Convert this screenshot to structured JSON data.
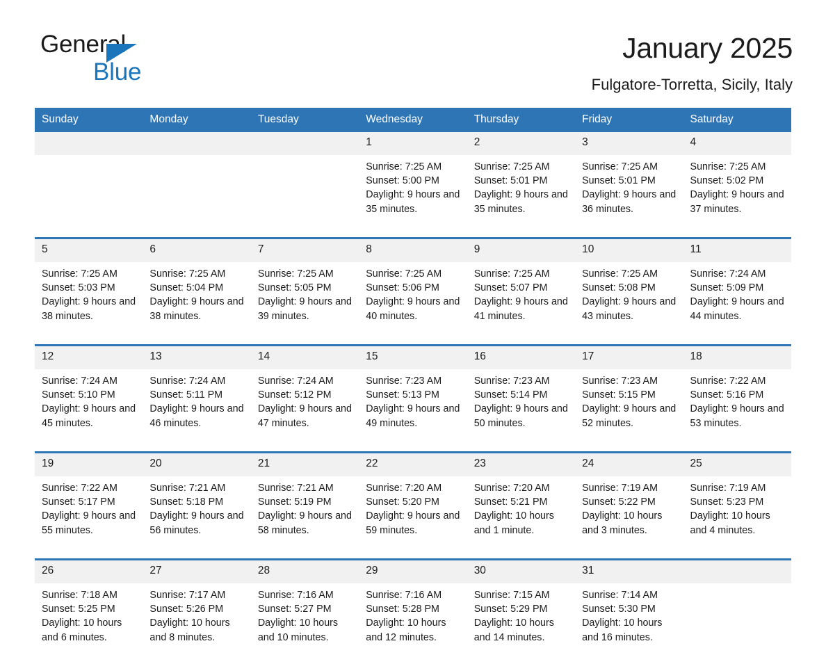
{
  "logo": {
    "word1": "General",
    "word2": "Blue",
    "accent_color": "#1b75bb",
    "triangle_icon": "triangle-icon"
  },
  "header": {
    "title": "January 2025",
    "subtitle": "Fulgatore-Torretta, Sicily, Italy"
  },
  "calendar": {
    "header_bg": "#2e75b6",
    "daynum_bg": "#f1f1f1",
    "weekdays": [
      "Sunday",
      "Monday",
      "Tuesday",
      "Wednesday",
      "Thursday",
      "Friday",
      "Saturday"
    ],
    "labels": {
      "sunrise": "Sunrise:",
      "sunset": "Sunset:",
      "daylight": "Daylight:"
    },
    "weeks": [
      [
        {
          "day": "",
          "sunrise": "",
          "sunset": "",
          "daylight": ""
        },
        {
          "day": "",
          "sunrise": "",
          "sunset": "",
          "daylight": ""
        },
        {
          "day": "",
          "sunrise": "",
          "sunset": "",
          "daylight": ""
        },
        {
          "day": "1",
          "sunrise": "Sunrise: 7:25 AM",
          "sunset": "Sunset: 5:00 PM",
          "daylight": "Daylight: 9 hours and 35 minutes."
        },
        {
          "day": "2",
          "sunrise": "Sunrise: 7:25 AM",
          "sunset": "Sunset: 5:01 PM",
          "daylight": "Daylight: 9 hours and 35 minutes."
        },
        {
          "day": "3",
          "sunrise": "Sunrise: 7:25 AM",
          "sunset": "Sunset: 5:01 PM",
          "daylight": "Daylight: 9 hours and 36 minutes."
        },
        {
          "day": "4",
          "sunrise": "Sunrise: 7:25 AM",
          "sunset": "Sunset: 5:02 PM",
          "daylight": "Daylight: 9 hours and 37 minutes."
        }
      ],
      [
        {
          "day": "5",
          "sunrise": "Sunrise: 7:25 AM",
          "sunset": "Sunset: 5:03 PM",
          "daylight": "Daylight: 9 hours and 38 minutes."
        },
        {
          "day": "6",
          "sunrise": "Sunrise: 7:25 AM",
          "sunset": "Sunset: 5:04 PM",
          "daylight": "Daylight: 9 hours and 38 minutes."
        },
        {
          "day": "7",
          "sunrise": "Sunrise: 7:25 AM",
          "sunset": "Sunset: 5:05 PM",
          "daylight": "Daylight: 9 hours and 39 minutes."
        },
        {
          "day": "8",
          "sunrise": "Sunrise: 7:25 AM",
          "sunset": "Sunset: 5:06 PM",
          "daylight": "Daylight: 9 hours and 40 minutes."
        },
        {
          "day": "9",
          "sunrise": "Sunrise: 7:25 AM",
          "sunset": "Sunset: 5:07 PM",
          "daylight": "Daylight: 9 hours and 41 minutes."
        },
        {
          "day": "10",
          "sunrise": "Sunrise: 7:25 AM",
          "sunset": "Sunset: 5:08 PM",
          "daylight": "Daylight: 9 hours and 43 minutes."
        },
        {
          "day": "11",
          "sunrise": "Sunrise: 7:24 AM",
          "sunset": "Sunset: 5:09 PM",
          "daylight": "Daylight: 9 hours and 44 minutes."
        }
      ],
      [
        {
          "day": "12",
          "sunrise": "Sunrise: 7:24 AM",
          "sunset": "Sunset: 5:10 PM",
          "daylight": "Daylight: 9 hours and 45 minutes."
        },
        {
          "day": "13",
          "sunrise": "Sunrise: 7:24 AM",
          "sunset": "Sunset: 5:11 PM",
          "daylight": "Daylight: 9 hours and 46 minutes."
        },
        {
          "day": "14",
          "sunrise": "Sunrise: 7:24 AM",
          "sunset": "Sunset: 5:12 PM",
          "daylight": "Daylight: 9 hours and 47 minutes."
        },
        {
          "day": "15",
          "sunrise": "Sunrise: 7:23 AM",
          "sunset": "Sunset: 5:13 PM",
          "daylight": "Daylight: 9 hours and 49 minutes."
        },
        {
          "day": "16",
          "sunrise": "Sunrise: 7:23 AM",
          "sunset": "Sunset: 5:14 PM",
          "daylight": "Daylight: 9 hours and 50 minutes."
        },
        {
          "day": "17",
          "sunrise": "Sunrise: 7:23 AM",
          "sunset": "Sunset: 5:15 PM",
          "daylight": "Daylight: 9 hours and 52 minutes."
        },
        {
          "day": "18",
          "sunrise": "Sunrise: 7:22 AM",
          "sunset": "Sunset: 5:16 PM",
          "daylight": "Daylight: 9 hours and 53 minutes."
        }
      ],
      [
        {
          "day": "19",
          "sunrise": "Sunrise: 7:22 AM",
          "sunset": "Sunset: 5:17 PM",
          "daylight": "Daylight: 9 hours and 55 minutes."
        },
        {
          "day": "20",
          "sunrise": "Sunrise: 7:21 AM",
          "sunset": "Sunset: 5:18 PM",
          "daylight": "Daylight: 9 hours and 56 minutes."
        },
        {
          "day": "21",
          "sunrise": "Sunrise: 7:21 AM",
          "sunset": "Sunset: 5:19 PM",
          "daylight": "Daylight: 9 hours and 58 minutes."
        },
        {
          "day": "22",
          "sunrise": "Sunrise: 7:20 AM",
          "sunset": "Sunset: 5:20 PM",
          "daylight": "Daylight: 9 hours and 59 minutes."
        },
        {
          "day": "23",
          "sunrise": "Sunrise: 7:20 AM",
          "sunset": "Sunset: 5:21 PM",
          "daylight": "Daylight: 10 hours and 1 minute."
        },
        {
          "day": "24",
          "sunrise": "Sunrise: 7:19 AM",
          "sunset": "Sunset: 5:22 PM",
          "daylight": "Daylight: 10 hours and 3 minutes."
        },
        {
          "day": "25",
          "sunrise": "Sunrise: 7:19 AM",
          "sunset": "Sunset: 5:23 PM",
          "daylight": "Daylight: 10 hours and 4 minutes."
        }
      ],
      [
        {
          "day": "26",
          "sunrise": "Sunrise: 7:18 AM",
          "sunset": "Sunset: 5:25 PM",
          "daylight": "Daylight: 10 hours and 6 minutes."
        },
        {
          "day": "27",
          "sunrise": "Sunrise: 7:17 AM",
          "sunset": "Sunset: 5:26 PM",
          "daylight": "Daylight: 10 hours and 8 minutes."
        },
        {
          "day": "28",
          "sunrise": "Sunrise: 7:16 AM",
          "sunset": "Sunset: 5:27 PM",
          "daylight": "Daylight: 10 hours and 10 minutes."
        },
        {
          "day": "29",
          "sunrise": "Sunrise: 7:16 AM",
          "sunset": "Sunset: 5:28 PM",
          "daylight": "Daylight: 10 hours and 12 minutes."
        },
        {
          "day": "30",
          "sunrise": "Sunrise: 7:15 AM",
          "sunset": "Sunset: 5:29 PM",
          "daylight": "Daylight: 10 hours and 14 minutes."
        },
        {
          "day": "31",
          "sunrise": "Sunrise: 7:14 AM",
          "sunset": "Sunset: 5:30 PM",
          "daylight": "Daylight: 10 hours and 16 minutes."
        },
        {
          "day": "",
          "sunrise": "",
          "sunset": "",
          "daylight": ""
        }
      ]
    ]
  }
}
